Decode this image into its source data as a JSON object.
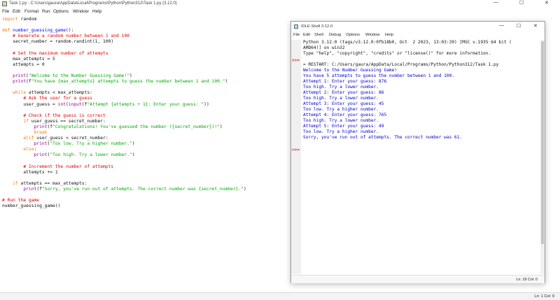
{
  "window": {
    "title": "Task 1.py - C:\\Users\\gaura\\AppData\\Local\\Programs\\Python\\Python312\\Task 1.py (3.12.0)",
    "minimize": "—",
    "maximize": "☐",
    "close": "✕"
  },
  "menu": [
    "File",
    "Edit",
    "Format",
    "Run",
    "Options",
    "Window",
    "Help"
  ],
  "code": [
    [
      {
        "t": "import",
        "c": "kw"
      },
      {
        "t": " random",
        "c": "plain"
      }
    ],
    [],
    [
      {
        "t": "def ",
        "c": "kw"
      },
      {
        "t": "number_guessing_game",
        "c": "def"
      },
      {
        "t": "():",
        "c": "plain"
      }
    ],
    [
      {
        "t": "    # Generate a random number between 1 and 100",
        "c": "com"
      }
    ],
    [
      {
        "t": "    secret_number = random.randint(1, 100)",
        "c": "plain"
      }
    ],
    [],
    [
      {
        "t": "    # Set the maximum number of attempts",
        "c": "com"
      }
    ],
    [
      {
        "t": "    max_attempts = 5",
        "c": "plain"
      }
    ],
    [
      {
        "t": "    attempts = 0",
        "c": "plain"
      }
    ],
    [],
    [
      {
        "t": "    ",
        "c": "plain"
      },
      {
        "t": "print",
        "c": "bi"
      },
      {
        "t": "(",
        "c": "plain"
      },
      {
        "t": "\"Welcome to the Number Guessing Game!\"",
        "c": "str"
      },
      {
        "t": ")",
        "c": "plain"
      }
    ],
    [
      {
        "t": "    ",
        "c": "plain"
      },
      {
        "t": "print",
        "c": "bi"
      },
      {
        "t": "(f",
        "c": "plain"
      },
      {
        "t": "\"You have {max_attempts} attempts to guess the number between 1 and 100.\"",
        "c": "str"
      },
      {
        "t": ")",
        "c": "plain"
      }
    ],
    [],
    [
      {
        "t": "    ",
        "c": "plain"
      },
      {
        "t": "while",
        "c": "kw"
      },
      {
        "t": " attempts < max_attempts:",
        "c": "plain"
      }
    ],
    [
      {
        "t": "        # Ask the user for a guess",
        "c": "com"
      }
    ],
    [
      {
        "t": "        user_guess = ",
        "c": "plain"
      },
      {
        "t": "int",
        "c": "bi"
      },
      {
        "t": "(",
        "c": "plain"
      },
      {
        "t": "input",
        "c": "bi"
      },
      {
        "t": "(f",
        "c": "plain"
      },
      {
        "t": "\"Attempt {attempts + 1}: Enter your guess: \"",
        "c": "str"
      },
      {
        "t": "))",
        "c": "plain"
      }
    ],
    [],
    [
      {
        "t": "        # Check if the guess is correct",
        "c": "com"
      }
    ],
    [
      {
        "t": "        ",
        "c": "plain"
      },
      {
        "t": "if",
        "c": "kw"
      },
      {
        "t": " user_guess == secret_number:",
        "c": "plain"
      }
    ],
    [
      {
        "t": "            ",
        "c": "plain"
      },
      {
        "t": "print",
        "c": "bi"
      },
      {
        "t": "(f",
        "c": "plain"
      },
      {
        "t": "\"Congratulations! You've guessed the number ({secret_number})!\"",
        "c": "str"
      },
      {
        "t": ")",
        "c": "plain"
      }
    ],
    [
      {
        "t": "            ",
        "c": "plain"
      },
      {
        "t": "break",
        "c": "kw"
      }
    ],
    [
      {
        "t": "        ",
        "c": "plain"
      },
      {
        "t": "elif",
        "c": "kw"
      },
      {
        "t": " user_guess < secret_number:",
        "c": "plain"
      }
    ],
    [
      {
        "t": "            ",
        "c": "plain"
      },
      {
        "t": "print",
        "c": "bi"
      },
      {
        "t": "(",
        "c": "plain"
      },
      {
        "t": "\"Too low. Try a higher number.\"",
        "c": "str"
      },
      {
        "t": ")",
        "c": "plain"
      }
    ],
    [
      {
        "t": "        ",
        "c": "plain"
      },
      {
        "t": "else",
        "c": "kw"
      },
      {
        "t": ":",
        "c": "plain"
      }
    ],
    [
      {
        "t": "            ",
        "c": "plain"
      },
      {
        "t": "print",
        "c": "bi"
      },
      {
        "t": "(",
        "c": "plain"
      },
      {
        "t": "\"Too high. Try a lower number.\"",
        "c": "str"
      },
      {
        "t": ")",
        "c": "plain"
      }
    ],
    [],
    [
      {
        "t": "        # Increment the number of attempts",
        "c": "com"
      }
    ],
    [
      {
        "t": "        attempts += 1",
        "c": "plain"
      }
    ],
    [],
    [
      {
        "t": "    ",
        "c": "plain"
      },
      {
        "t": "if",
        "c": "kw"
      },
      {
        "t": " attempts == max_attempts:",
        "c": "plain"
      }
    ],
    [
      {
        "t": "        ",
        "c": "plain"
      },
      {
        "t": "print",
        "c": "bi"
      },
      {
        "t": "(f",
        "c": "plain"
      },
      {
        "t": "\"Sorry, you've run out of attempts. The correct number was {secret_number}.\"",
        "c": "str"
      },
      {
        "t": ")",
        "c": "plain"
      }
    ],
    [],
    [
      {
        "t": "# Run the game",
        "c": "com"
      }
    ],
    [
      {
        "t": "number_guessing_game()",
        "c": "plain"
      }
    ]
  ],
  "editor_status": "Ln: 1   Col: 0",
  "shell": {
    "title": "IDLE Shell 3.12.0",
    "minimize": "—",
    "maximize": "☐",
    "close": "✕",
    "menu": [
      "File",
      "Edit",
      "Shell",
      "Debug",
      "Options",
      "Window",
      "Help"
    ],
    "lines": [
      {
        "t": "Python 3.12.0 (tags/v3.12.0:0fb18b0, Oct  2 2023, 13:03:39) [MSC v.1935 64 bit (",
        "c": "plain"
      },
      {
        "t": "AMD64)] on win32",
        "c": "plain"
      },
      {
        "t": "Type \"help\", \"copyright\", \"credits\" or \"license()\" for more information.",
        "c": "plain"
      },
      {
        "t": "",
        "c": "plain"
      },
      {
        "t": "= RESTART: C:/Users/gaura/AppData/Local/Programs/Python/Python312/Task 1.py",
        "c": "plain"
      },
      {
        "t": "Welcome to the Number Guessing Game!",
        "c": "out"
      },
      {
        "t": "You have 5 attempts to guess the number between 1 and 100.",
        "c": "out"
      },
      {
        "t": "Attempt 1: Enter your guess: 876",
        "c": "out"
      },
      {
        "t": "Too high. Try a lower number.",
        "c": "out"
      },
      {
        "t": "Attempt 2: Enter your guess: 86",
        "c": "out"
      },
      {
        "t": "Too high. Try a lower number.",
        "c": "out"
      },
      {
        "t": "Attempt 3: Enter your guess: 45",
        "c": "out"
      },
      {
        "t": "Too low. Try a higher number.",
        "c": "out"
      },
      {
        "t": "Attempt 4: Enter your guess: 765",
        "c": "out"
      },
      {
        "t": "Too high. Try a lower number.",
        "c": "out"
      },
      {
        "t": "Attempt 5: Enter your guess: 49",
        "c": "out"
      },
      {
        "t": "Too low. Try a higher number.",
        "c": "out"
      },
      {
        "t": "Sorry, you've run out of attempts. The correct number was 61.",
        "c": "out"
      }
    ],
    "prompts": [
      ">>>",
      ">>>"
    ],
    "status": "Ln: 18   Col: 0"
  }
}
